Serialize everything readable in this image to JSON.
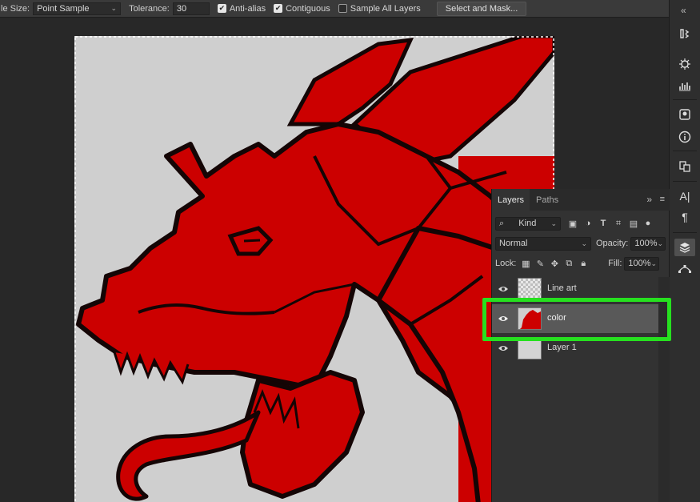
{
  "options_bar": {
    "sample_size_label": "le Size:",
    "sample_size_value": "Point Sample",
    "tolerance_label": "Tolerance:",
    "tolerance_value": "30",
    "anti_alias_label": "Anti-alias",
    "anti_alias_checked": true,
    "contiguous_label": "Contiguous",
    "contiguous_checked": true,
    "sample_all_layers_label": "Sample All Layers",
    "sample_all_layers_checked": false,
    "select_and_mask_label": "Select and Mask..."
  },
  "right_toolstrip": {
    "icons": [
      "history-icon",
      "brush-settings-icon",
      "levels-icon",
      "libraries-icon",
      "info-icon",
      "clone-source-icon",
      "character-icon",
      "paragraph-icon",
      "layers-icon",
      "paths-icon"
    ],
    "active": "layers-icon",
    "close_glyph": "«"
  },
  "layers_panel": {
    "tabs": [
      {
        "label": "Layers",
        "active": true
      },
      {
        "label": "Paths",
        "active": false
      }
    ],
    "collapse_glyph": "»",
    "menu_glyph": "≡",
    "filter_kind": "Kind",
    "blend_mode": "Normal",
    "opacity_label": "Opacity:",
    "opacity_value": "100%",
    "lock_label": "Lock:",
    "fill_label": "Fill:",
    "fill_value": "100%",
    "layers": [
      {
        "name": "Line art",
        "visible": true,
        "selected": false,
        "thumb": "transparent"
      },
      {
        "name": "color",
        "visible": true,
        "selected": true,
        "thumb": "red"
      },
      {
        "name": "Layer 1",
        "visible": true,
        "selected": false,
        "thumb": "gray"
      }
    ]
  },
  "colors": {
    "dragon_red": "#cc0000",
    "background_gray": "#cfcfcf",
    "outline": "#140505",
    "highlight_green": "#26e01f",
    "panel": "#323232",
    "options_bar": "#3a3a3a"
  }
}
